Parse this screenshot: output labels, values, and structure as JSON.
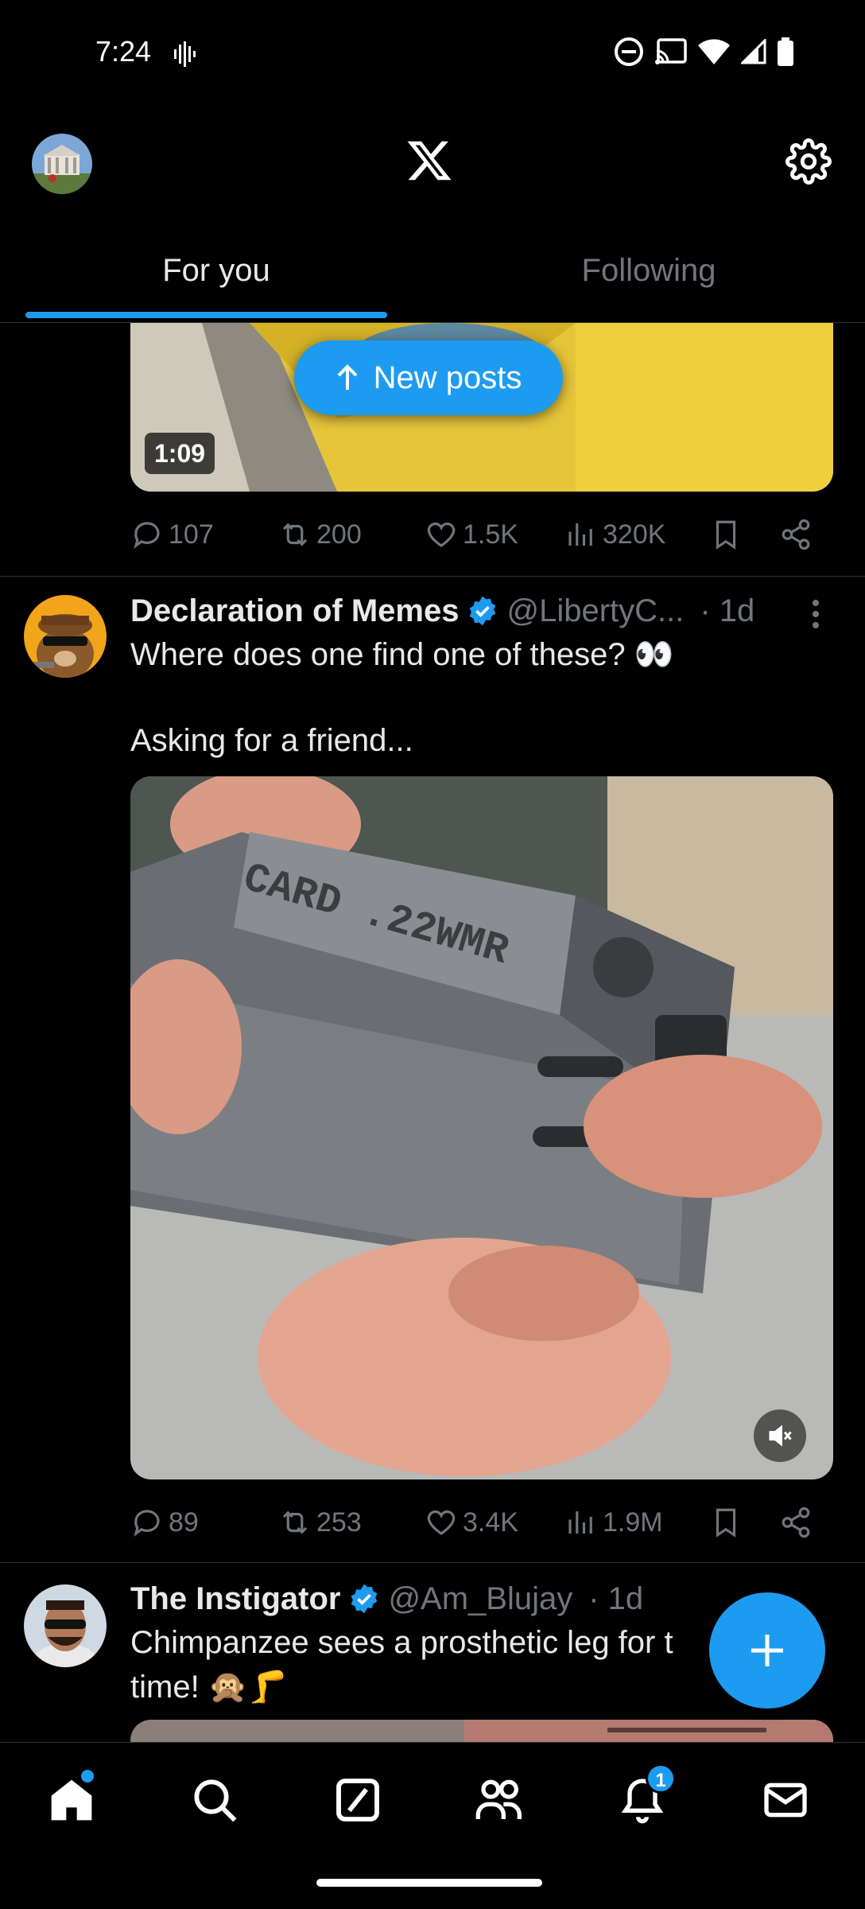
{
  "status_bar": {
    "time": "7:24"
  },
  "header": {
    "tabs": [
      {
        "label": "For you",
        "active": true
      },
      {
        "label": "Following",
        "active": false
      }
    ]
  },
  "new_posts": {
    "label": "New posts"
  },
  "prev_post": {
    "duration": "1:09",
    "replies": "107",
    "reposts": "200",
    "likes": "1.5K",
    "views": "320K"
  },
  "post1": {
    "name": "Declaration of Memes",
    "handle": "@LibertyC...",
    "time": "· 1d",
    "text_line1": "Where does one find one of these? 👀",
    "text_line2": "Asking for a friend...",
    "media_text": "CARD .22WMR",
    "replies": "89",
    "reposts": "253",
    "likes": "3.4K",
    "views": "1.9M"
  },
  "post2": {
    "name": "The Instigator",
    "handle": "@Am_Blujay",
    "time": "· 1d",
    "text_line1": "Chimpanzee sees a prosthetic leg for t",
    "text_line2": "time! 🙊🦵"
  },
  "bottom_nav": {
    "notifications_badge": "1"
  },
  "colors": {
    "accent": "#1d9bf0",
    "background": "#000000",
    "muted": "#71767b",
    "text": "#e7e9ea"
  }
}
